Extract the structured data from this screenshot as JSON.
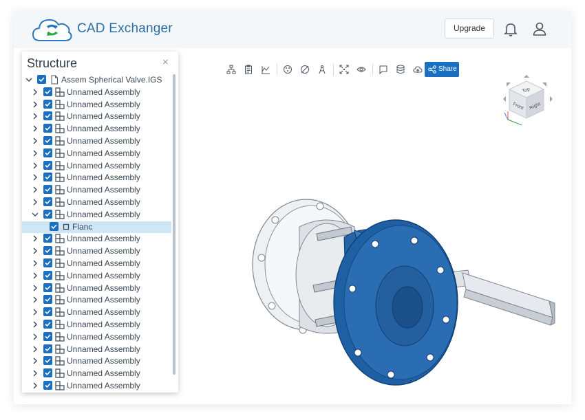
{
  "header": {
    "app_title": "CAD Exchanger",
    "upgrade_label": "Upgrade",
    "icons": [
      "cloud-logo-icon",
      "bell-icon",
      "user-icon"
    ]
  },
  "structure": {
    "title": "Structure",
    "close_glyph": "×",
    "root_label": "Assem Spherical Valve.IGS",
    "items": [
      {
        "label": "Unnamed Assembly",
        "expanded": false
      },
      {
        "label": "Unnamed Assembly",
        "expanded": false
      },
      {
        "label": "Unnamed Assembly",
        "expanded": false
      },
      {
        "label": "Unnamed Assembly",
        "expanded": false
      },
      {
        "label": "Unnamed Assembly",
        "expanded": false
      },
      {
        "label": "Unnamed Assembly",
        "expanded": false
      },
      {
        "label": "Unnamed Assembly",
        "expanded": false
      },
      {
        "label": "Unnamed Assembly",
        "expanded": false
      },
      {
        "label": "Unnamed Assembly",
        "expanded": false
      },
      {
        "label": "Unnamed Assembly",
        "expanded": false
      },
      {
        "label": "Unnamed Assembly",
        "expanded": true
      },
      {
        "label": "Flanc",
        "part": true,
        "selected": true
      },
      {
        "label": "Unnamed Assembly",
        "expanded": false
      },
      {
        "label": "Unnamed Assembly",
        "expanded": false
      },
      {
        "label": "Unnamed Assembly",
        "expanded": false
      },
      {
        "label": "Unnamed Assembly",
        "expanded": false
      },
      {
        "label": "Unnamed Assembly",
        "expanded": false
      },
      {
        "label": "Unnamed Assembly",
        "expanded": false
      },
      {
        "label": "Unnamed Assembly",
        "expanded": false
      },
      {
        "label": "Unnamed Assembly",
        "expanded": false
      },
      {
        "label": "Unnamed Assembly",
        "expanded": false
      },
      {
        "label": "Unnamed Assembly",
        "expanded": false
      },
      {
        "label": "Unnamed Assembly",
        "expanded": false
      },
      {
        "label": "Unnamed Assembly",
        "expanded": false
      },
      {
        "label": "Unnamed Assembly",
        "expanded": false
      }
    ]
  },
  "toolbar": {
    "share_label": "Share",
    "icons": [
      "structure-tree-icon",
      "properties-icon",
      "measurements-icon",
      "explode-icon",
      "section-icon",
      "compass-icon",
      "fit-view-icon",
      "visibility-icon",
      "comment-icon",
      "layers-icon",
      "cloud-upload-icon",
      "share-icon"
    ]
  },
  "view_cube": {
    "top": "Top",
    "front": "Front",
    "right": "Right"
  },
  "colors": {
    "accent": "#1a6fc0",
    "brand_text": "#2b6fa6",
    "selection": "#cfe6f7",
    "model_blue": "#1f5fa3"
  }
}
